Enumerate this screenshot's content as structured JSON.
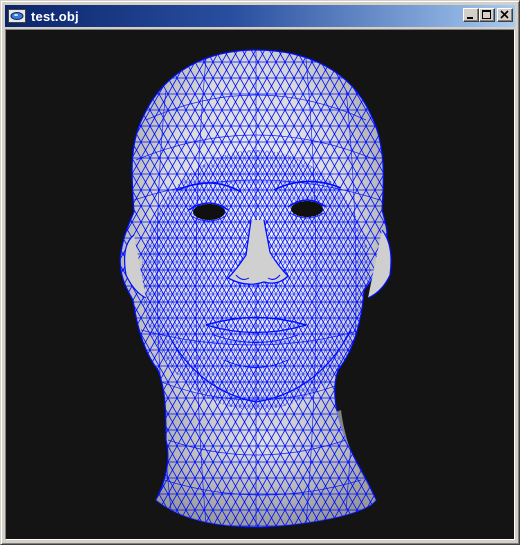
{
  "window": {
    "title": "test.obj",
    "app_icon": "opengl-app-icon",
    "buttons": {
      "minimize": "minimize-icon",
      "maximize": "maximize-icon",
      "close": "close-icon"
    }
  },
  "viewport": {
    "content": "wireframe-head-mesh",
    "background_color": "#141414",
    "mesh_fill_color": "#d8d8d8",
    "wire_color": "#0000ff"
  }
}
